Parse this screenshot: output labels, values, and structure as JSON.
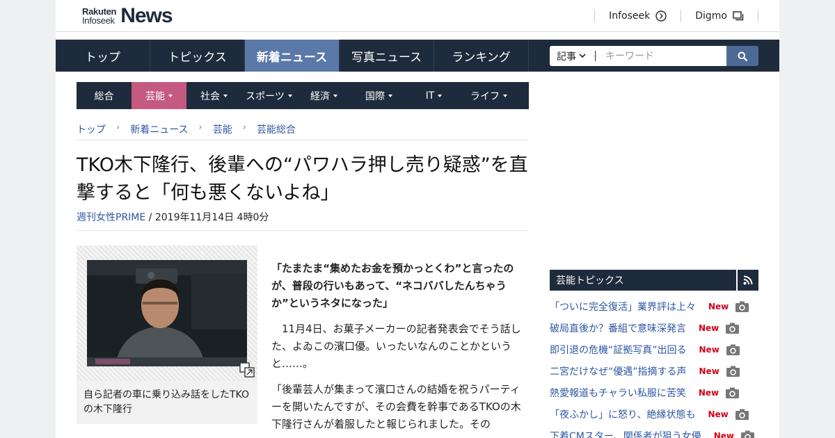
{
  "header": {
    "logo_small_top": "Rakuten",
    "logo_small_bottom": "Infoseek",
    "logo_big": "News",
    "ext_links": [
      {
        "label": "Infoseek",
        "icon": "circle-arrow-icon"
      },
      {
        "label": "Digmo",
        "icon": "windows-icon"
      }
    ]
  },
  "main_nav": {
    "items": [
      {
        "label": "トップ",
        "active": false
      },
      {
        "label": "トピックス",
        "active": false
      },
      {
        "label": "新着ニュース",
        "active": true
      },
      {
        "label": "写真ニュース",
        "active": false
      },
      {
        "label": "ランキング",
        "active": false
      }
    ],
    "search": {
      "select_label": "記事",
      "placeholder": "キーワード",
      "icon": "search-icon"
    }
  },
  "category_nav": {
    "items": [
      {
        "label": "総合",
        "has_menu": false,
        "active": false
      },
      {
        "label": "芸能",
        "has_menu": true,
        "active": true
      },
      {
        "label": "社会",
        "has_menu": true,
        "active": false
      },
      {
        "label": "スポーツ",
        "has_menu": true,
        "active": false
      },
      {
        "label": "経済",
        "has_menu": true,
        "active": false
      },
      {
        "label": "国際",
        "has_menu": true,
        "active": false
      },
      {
        "label": "IT",
        "has_menu": true,
        "active": false
      },
      {
        "label": "ライフ",
        "has_menu": true,
        "active": false
      }
    ]
  },
  "breadcrumb": [
    "トップ",
    "新着ニュース",
    "芸能",
    "芸能総合"
  ],
  "article": {
    "title": "TKO木下隆行、後輩への“パワハラ押し売り疑惑”を直撃すると「何も悪くないよね」",
    "source": "週刊女性PRIME",
    "date": " / 2019年11月14日 4時0分",
    "photo_caption": "自ら記者の車に乗り込み話をしたTKOの木下隆行",
    "lead": "「たまたま“集めたお金を預かっとくわ”と言ったのが、普段の行いもあって、“ネコババしたんちゃうか”というネタになった」",
    "paragraphs": [
      "　11月4日、お菓子メーカーの記者発表会でそう話した、よゐこの濱口優。いったいなんのことかというと……。",
      "「後輩芸人が集まって濱口さんの結婚を祝うパーティーを開いたんですが、その会費を幹事であるTKOの木下隆行さんが着服したと報じられました。その"
    ]
  },
  "sidebar": {
    "heading": "芸能トピックス",
    "new_label": "New",
    "topics": [
      "「ついに完全復活」業界評は上々",
      "破局直後か？番組で意味深発言",
      "即引退の危機“証拠写真”出回る",
      "二宮だけなぜ“優遇”指摘する声",
      "熱愛報道もチャラい私服に苦笑",
      "「夜ふかし」に怒り、絶縁状態も",
      "下着CMスター、関係者が狙う女優"
    ]
  },
  "colors": {
    "nav_bg": "#1e2b3c",
    "nav_active": "#5a78a8",
    "category_active": "#c45a7f",
    "link": "#2d56a3",
    "new_badge": "#d0021b"
  }
}
